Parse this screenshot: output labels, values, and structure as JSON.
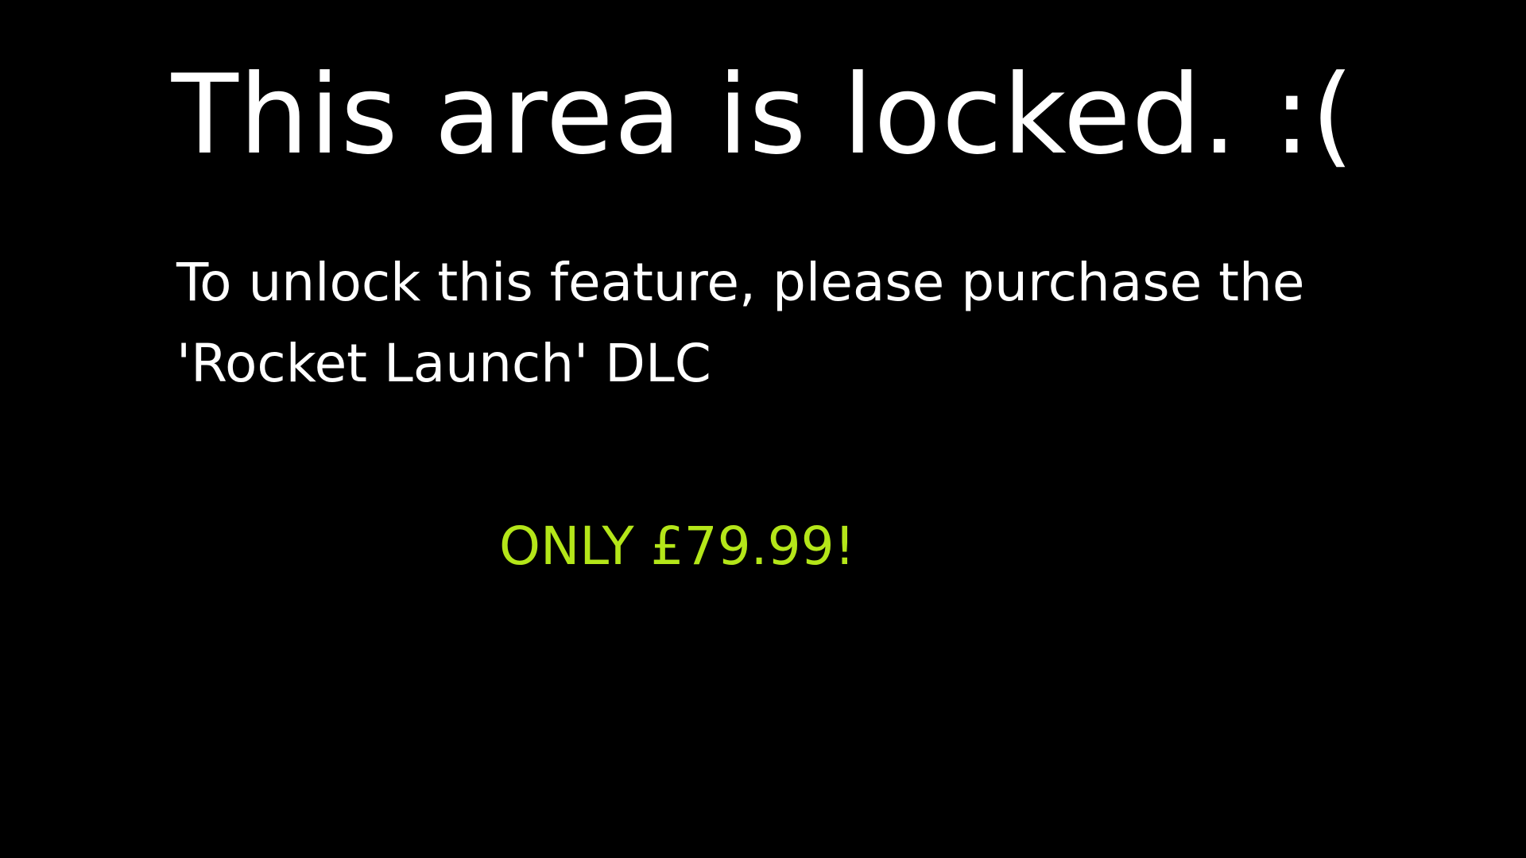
{
  "locked_screen": {
    "title": "This area is locked. :(",
    "message_line_1": "To unlock this feature, please purchase the",
    "message_line_2": "'Rocket Launch' DLC",
    "price_text": "ONLY £79.99!"
  },
  "colors": {
    "background": "#000000",
    "text": "#ffffff",
    "price_accent": "#b4e619"
  }
}
